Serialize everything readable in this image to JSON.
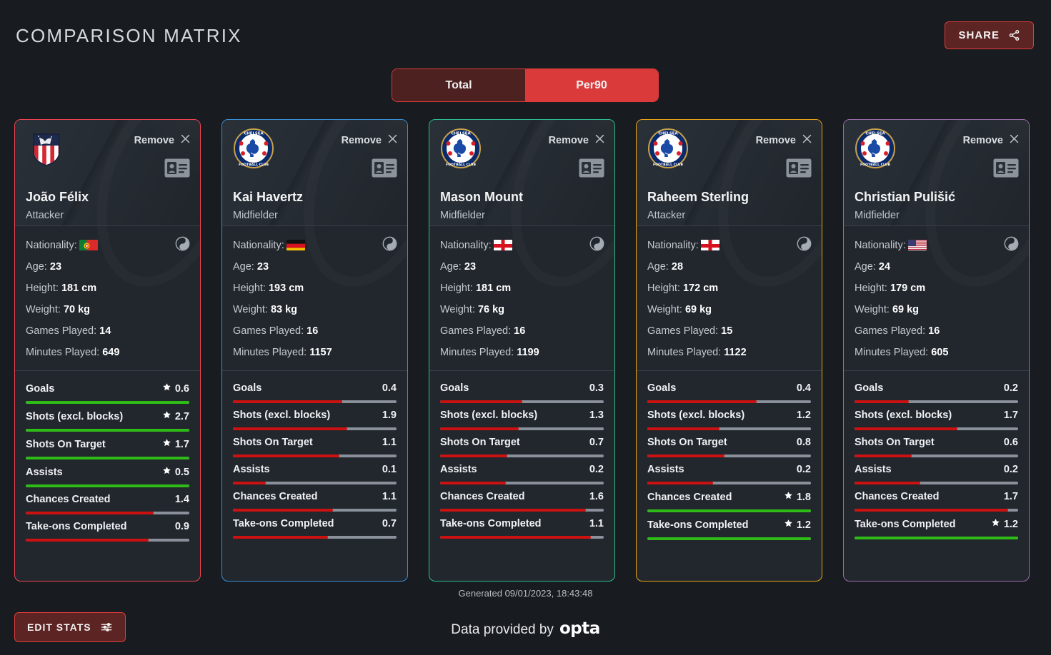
{
  "header": {
    "title": "COMPARISON MATRIX",
    "share_label": "SHARE",
    "share_icon": "share-icon"
  },
  "mode_toggle": {
    "options": [
      {
        "label": "Total",
        "active": false
      },
      {
        "label": "Per90",
        "active": true
      }
    ]
  },
  "labels": {
    "remove": "Remove",
    "nationality": "Nationality:",
    "age": "Age:",
    "height": "Height:",
    "weight": "Weight:",
    "games_played": "Games Played:",
    "minutes_played": "Minutes Played:"
  },
  "colors": {
    "accent_red": "#e03b3b",
    "bar_red": "#cc1111",
    "bar_best_green": "#2fbb17",
    "bar_track_gray": "#8a9099",
    "page_background": "#181c21",
    "card_background": "#22272e"
  },
  "cards": [
    {
      "border_color": "#ef4352",
      "crest": "atletico-madrid-crest",
      "name": "João Félix",
      "position": "Attacker",
      "nationality": "portugal-flag",
      "age": "23",
      "height": "181 cm",
      "weight": "70 kg",
      "games_played": "14",
      "minutes_played": "649",
      "stats": [
        {
          "label": "Goals",
          "value": "0.6",
          "best": true,
          "pct": 100
        },
        {
          "label": "Shots (excl. blocks)",
          "value": "2.7",
          "best": true,
          "pct": 100
        },
        {
          "label": "Shots On Target",
          "value": "1.7",
          "best": true,
          "pct": 100
        },
        {
          "label": "Assists",
          "value": "0.5",
          "best": true,
          "pct": 100
        },
        {
          "label": "Chances Created",
          "value": "1.4",
          "best": false,
          "pct": 78
        },
        {
          "label": "Take-ons Completed",
          "value": "0.9",
          "best": false,
          "pct": 75
        }
      ]
    },
    {
      "border_color": "#3b8fd4",
      "crest": "chelsea-crest",
      "name": "Kai Havertz",
      "position": "Midfielder",
      "nationality": "germany-flag",
      "age": "23",
      "height": "193 cm",
      "weight": "83 kg",
      "games_played": "16",
      "minutes_played": "1157",
      "stats": [
        {
          "label": "Goals",
          "value": "0.4",
          "best": false,
          "pct": 67
        },
        {
          "label": "Shots (excl. blocks)",
          "value": "1.9",
          "best": false,
          "pct": 70
        },
        {
          "label": "Shots On Target",
          "value": "1.1",
          "best": false,
          "pct": 65
        },
        {
          "label": "Assists",
          "value": "0.1",
          "best": false,
          "pct": 20
        },
        {
          "label": "Chances Created",
          "value": "1.1",
          "best": false,
          "pct": 61
        },
        {
          "label": "Take-ons Completed",
          "value": "0.7",
          "best": false,
          "pct": 58
        }
      ]
    },
    {
      "border_color": "#2dbd8e",
      "crest": "chelsea-crest",
      "name": "Mason Mount",
      "position": "Midfielder",
      "nationality": "england-flag",
      "age": "23",
      "height": "181 cm",
      "weight": "76 kg",
      "games_played": "16",
      "minutes_played": "1199",
      "stats": [
        {
          "label": "Goals",
          "value": "0.3",
          "best": false,
          "pct": 50
        },
        {
          "label": "Shots (excl. blocks)",
          "value": "1.3",
          "best": false,
          "pct": 48
        },
        {
          "label": "Shots On Target",
          "value": "0.7",
          "best": false,
          "pct": 41
        },
        {
          "label": "Assists",
          "value": "0.2",
          "best": false,
          "pct": 40
        },
        {
          "label": "Chances Created",
          "value": "1.6",
          "best": false,
          "pct": 89
        },
        {
          "label": "Take-ons Completed",
          "value": "1.1",
          "best": false,
          "pct": 92
        }
      ]
    },
    {
      "border_color": "#e8a317",
      "crest": "chelsea-crest",
      "name": "Raheem Sterling",
      "position": "Attacker",
      "nationality": "england-flag",
      "age": "28",
      "height": "172 cm",
      "weight": "69 kg",
      "games_played": "15",
      "minutes_played": "1122",
      "stats": [
        {
          "label": "Goals",
          "value": "0.4",
          "best": false,
          "pct": 67
        },
        {
          "label": "Shots (excl. blocks)",
          "value": "1.2",
          "best": false,
          "pct": 44
        },
        {
          "label": "Shots On Target",
          "value": "0.8",
          "best": false,
          "pct": 47
        },
        {
          "label": "Assists",
          "value": "0.2",
          "best": false,
          "pct": 40
        },
        {
          "label": "Chances Created",
          "value": "1.8",
          "best": true,
          "pct": 100
        },
        {
          "label": "Take-ons Completed",
          "value": "1.2",
          "best": true,
          "pct": 100
        }
      ]
    },
    {
      "border_color": "#9a6aa8",
      "crest": "chelsea-crest",
      "name": "Christian Pulišić",
      "position": "Midfielder",
      "nationality": "usa-flag",
      "age": "24",
      "height": "179 cm",
      "weight": "69 kg",
      "games_played": "16",
      "minutes_played": "605",
      "stats": [
        {
          "label": "Goals",
          "value": "0.2",
          "best": false,
          "pct": 33
        },
        {
          "label": "Shots (excl. blocks)",
          "value": "1.7",
          "best": false,
          "pct": 63
        },
        {
          "label": "Shots On Target",
          "value": "0.6",
          "best": false,
          "pct": 35
        },
        {
          "label": "Assists",
          "value": "0.2",
          "best": false,
          "pct": 40
        },
        {
          "label": "Chances Created",
          "value": "1.7",
          "best": false,
          "pct": 94
        },
        {
          "label": "Take-ons Completed",
          "value": "1.2",
          "best": true,
          "pct": 100
        }
      ]
    }
  ],
  "footer": {
    "edit_label": "EDIT STATS",
    "edit_icon": "tune-sliders-icon",
    "generated": "Generated 09/01/2023, 18:43:48",
    "provided_by": "Data provided by",
    "provider": "opta"
  }
}
